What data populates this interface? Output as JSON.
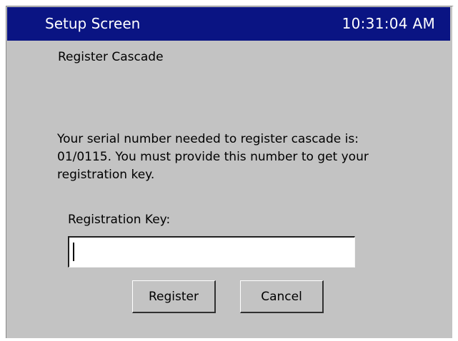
{
  "title_bar": {
    "title": "Setup Screen",
    "clock": "10:31:04 AM"
  },
  "dialog": {
    "heading": "Register Cascade",
    "message": "Your serial number needed to register cascade is: 01/0115.  You must provide this number to get your registration key.",
    "key_label": "Registration Key:",
    "key_value": "",
    "register_label": "Register",
    "cancel_label": "Cancel"
  },
  "colors": {
    "title_bar_bg": "#0a1483",
    "panel_bg": "#c3c3c3"
  }
}
